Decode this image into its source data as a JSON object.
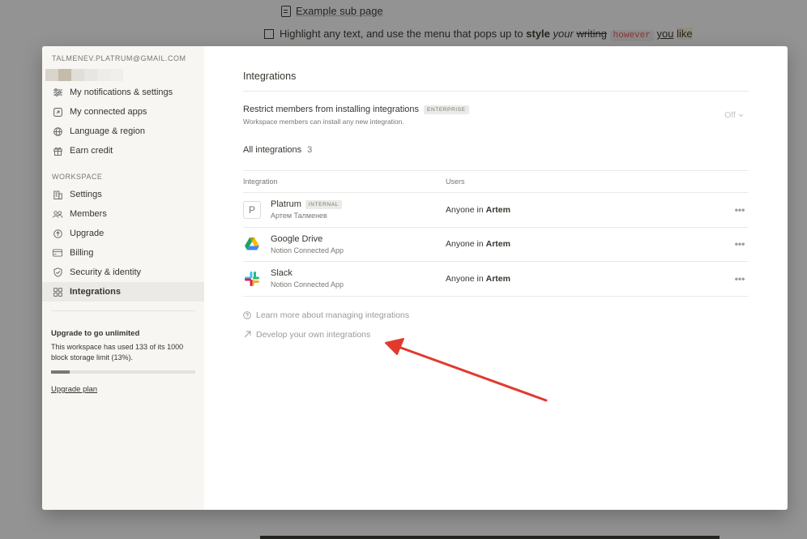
{
  "background": {
    "subpage_label": "Example sub page",
    "todo": {
      "text_prefix": "Highlight any text, and use the menu that pops up to ",
      "bold": "style",
      "italic": "your",
      "strike": "writing",
      "code": "however",
      "underline": "you",
      "highlight": "like"
    }
  },
  "sidebar": {
    "account_email": "TALMENEV.PLATRUM@GMAIL.COM",
    "account_items": [
      {
        "label": "My notifications & settings",
        "icon": "sliders-icon"
      },
      {
        "label": "My connected apps",
        "icon": "external-link-icon"
      },
      {
        "label": "Language & region",
        "icon": "globe-icon"
      },
      {
        "label": "Earn credit",
        "icon": "gift-icon"
      }
    ],
    "workspace_label": "WORKSPACE",
    "workspace_items": [
      {
        "label": "Settings",
        "icon": "building-icon"
      },
      {
        "label": "Members",
        "icon": "people-icon"
      },
      {
        "label": "Upgrade",
        "icon": "arrow-up-circle-icon"
      },
      {
        "label": "Billing",
        "icon": "credit-card-icon"
      },
      {
        "label": "Security & identity",
        "icon": "shield-icon"
      },
      {
        "label": "Integrations",
        "icon": "grid-icon",
        "active": true
      }
    ],
    "upgrade": {
      "title": "Upgrade to go unlimited",
      "description": "This workspace has used 133 of its 1000 block storage limit (13%).",
      "progress": 0.13,
      "link": "Upgrade plan"
    }
  },
  "content": {
    "title": "Integrations",
    "restrict": {
      "title": "Restrict members from installing integrations",
      "badge": "ENTERPRISE",
      "subtitle": "Workspace members can install any new integration.",
      "value": "Off"
    },
    "all_integrations_label": "All integrations",
    "all_integrations_count": "3",
    "table": {
      "headers": {
        "integration": "Integration",
        "users": "Users"
      },
      "rows": [
        {
          "name": "Platrum",
          "badge": "INTERNAL",
          "sub": "Артем Талменев",
          "users_prefix": "Anyone in ",
          "users_bold": "Artem",
          "logo": "P"
        },
        {
          "name": "Google Drive",
          "sub": "Notion Connected App",
          "users_prefix": "Anyone in ",
          "users_bold": "Artem",
          "logo": "google-drive-icon"
        },
        {
          "name": "Slack",
          "sub": "Notion Connected App",
          "users_prefix": "Anyone in ",
          "users_bold": "Artem",
          "logo": "slack-icon"
        }
      ],
      "more_label": "•••"
    },
    "learn_more": "Learn more about managing integrations",
    "develop": "Develop your own integrations"
  },
  "colors": {
    "annotation_arrow": "#e03a2f",
    "sidebar_bg": "#f7f6f3",
    "text": "#37352f",
    "muted": "#787774"
  }
}
